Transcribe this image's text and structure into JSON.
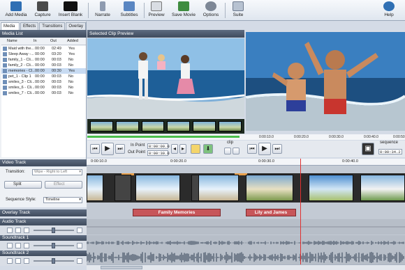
{
  "toolbar": {
    "add_media": "Add Media",
    "capture": "Capture",
    "insert_blank": "Insert Blank",
    "narrate": "Narrate",
    "subtitles": "Subtitles",
    "preview": "Preview",
    "save_movie": "Save Movie",
    "options": "Options",
    "suite": "Suite",
    "help": "Help"
  },
  "tabs": [
    "Media List",
    "Effects",
    "Transitions",
    "Overlay"
  ],
  "media_list": {
    "title": "Media List",
    "columns": [
      "Name",
      "In",
      "Out",
      "Added"
    ],
    "rows": [
      {
        "name": "Maid with the...",
        "in": "00:00",
        "out": "02:49",
        "added": "Yes"
      },
      {
        "name": "Sleep Away -...",
        "in": "00:00",
        "out": "03:20",
        "added": "Yes"
      },
      {
        "name": "family_1 - Cli...",
        "in": "00:00",
        "out": "00:03",
        "added": "No"
      },
      {
        "name": "family_2 - Cli...",
        "in": "00:00",
        "out": "00:03",
        "added": "No"
      },
      {
        "name": "memories - Cl...",
        "in": "00:00",
        "out": "00:30",
        "added": "Yes"
      },
      {
        "name": "pet_1 - Clip 1",
        "in": "00:00",
        "out": "00:03",
        "added": "No"
      },
      {
        "name": "smiles_3 - Cli...",
        "in": "00:00",
        "out": "00:03",
        "added": "No"
      },
      {
        "name": "smiles_6 - Cli...",
        "in": "00:00",
        "out": "00:03",
        "added": "No"
      },
      {
        "name": "smiles_7 - Cli...",
        "in": "00:00",
        "out": "00:03",
        "added": "No"
      }
    ]
  },
  "preview": {
    "title": "Selected Clip Preview",
    "in_point_label": "In Point",
    "out_point_label": "Out Point",
    "in_point": "0:00:00.0",
    "out_point": "0:00:30.0",
    "clip_label": "clip",
    "sequence_label": "sequence",
    "sequence_time": "0:00:34.2",
    "preview_ruler": [
      "0:00:10.0",
      "0:00:20.0",
      "0:00:30.0",
      "0:00:40.0",
      "0:00:50"
    ]
  },
  "timeline": {
    "ruler": [
      "0:00:10.0",
      "0:00:20.0",
      "0:00:30.0",
      "0:00:40.0"
    ],
    "video_track": "Video Track",
    "transition_label": "Transition:",
    "transition_value": "Wipe - Right to Left",
    "split": "Split",
    "effect": "Effect",
    "sequence_style_label": "Sequence Style:",
    "sequence_style_value": "Timeline",
    "overlay_track": "Overlay Track",
    "audio_track": "Audio Track",
    "soundtrack1": "Soundtrack 1",
    "soundtrack2": "Soundtrack 2",
    "captions": [
      "Family Memories",
      "Lily and James"
    ]
  }
}
